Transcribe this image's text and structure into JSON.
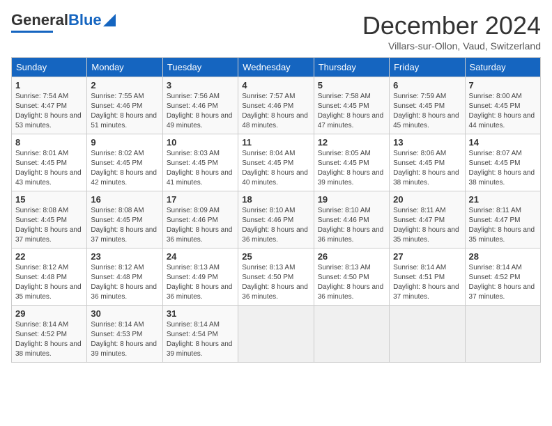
{
  "header": {
    "logo_general": "General",
    "logo_blue": "Blue",
    "title": "December 2024",
    "location": "Villars-sur-Ollon, Vaud, Switzerland"
  },
  "calendar": {
    "days_of_week": [
      "Sunday",
      "Monday",
      "Tuesday",
      "Wednesday",
      "Thursday",
      "Friday",
      "Saturday"
    ],
    "weeks": [
      [
        null,
        null,
        null,
        null,
        null,
        null,
        null
      ]
    ]
  },
  "cells": [
    {
      "day": "1",
      "sunrise": "7:54 AM",
      "sunset": "4:47 PM",
      "daylight": "8 hours and 53 minutes."
    },
    {
      "day": "2",
      "sunrise": "7:55 AM",
      "sunset": "4:46 PM",
      "daylight": "8 hours and 51 minutes."
    },
    {
      "day": "3",
      "sunrise": "7:56 AM",
      "sunset": "4:46 PM",
      "daylight": "8 hours and 49 minutes."
    },
    {
      "day": "4",
      "sunrise": "7:57 AM",
      "sunset": "4:46 PM",
      "daylight": "8 hours and 48 minutes."
    },
    {
      "day": "5",
      "sunrise": "7:58 AM",
      "sunset": "4:45 PM",
      "daylight": "8 hours and 47 minutes."
    },
    {
      "day": "6",
      "sunrise": "7:59 AM",
      "sunset": "4:45 PM",
      "daylight": "8 hours and 45 minutes."
    },
    {
      "day": "7",
      "sunrise": "8:00 AM",
      "sunset": "4:45 PM",
      "daylight": "8 hours and 44 minutes."
    },
    {
      "day": "8",
      "sunrise": "8:01 AM",
      "sunset": "4:45 PM",
      "daylight": "8 hours and 43 minutes."
    },
    {
      "day": "9",
      "sunrise": "8:02 AM",
      "sunset": "4:45 PM",
      "daylight": "8 hours and 42 minutes."
    },
    {
      "day": "10",
      "sunrise": "8:03 AM",
      "sunset": "4:45 PM",
      "daylight": "8 hours and 41 minutes."
    },
    {
      "day": "11",
      "sunrise": "8:04 AM",
      "sunset": "4:45 PM",
      "daylight": "8 hours and 40 minutes."
    },
    {
      "day": "12",
      "sunrise": "8:05 AM",
      "sunset": "4:45 PM",
      "daylight": "8 hours and 39 minutes."
    },
    {
      "day": "13",
      "sunrise": "8:06 AM",
      "sunset": "4:45 PM",
      "daylight": "8 hours and 38 minutes."
    },
    {
      "day": "14",
      "sunrise": "8:07 AM",
      "sunset": "4:45 PM",
      "daylight": "8 hours and 38 minutes."
    },
    {
      "day": "15",
      "sunrise": "8:08 AM",
      "sunset": "4:45 PM",
      "daylight": "8 hours and 37 minutes."
    },
    {
      "day": "16",
      "sunrise": "8:08 AM",
      "sunset": "4:45 PM",
      "daylight": "8 hours and 37 minutes."
    },
    {
      "day": "17",
      "sunrise": "8:09 AM",
      "sunset": "4:46 PM",
      "daylight": "8 hours and 36 minutes."
    },
    {
      "day": "18",
      "sunrise": "8:10 AM",
      "sunset": "4:46 PM",
      "daylight": "8 hours and 36 minutes."
    },
    {
      "day": "19",
      "sunrise": "8:10 AM",
      "sunset": "4:46 PM",
      "daylight": "8 hours and 36 minutes."
    },
    {
      "day": "20",
      "sunrise": "8:11 AM",
      "sunset": "4:47 PM",
      "daylight": "8 hours and 35 minutes."
    },
    {
      "day": "21",
      "sunrise": "8:11 AM",
      "sunset": "4:47 PM",
      "daylight": "8 hours and 35 minutes."
    },
    {
      "day": "22",
      "sunrise": "8:12 AM",
      "sunset": "4:48 PM",
      "daylight": "8 hours and 35 minutes."
    },
    {
      "day": "23",
      "sunrise": "8:12 AM",
      "sunset": "4:48 PM",
      "daylight": "8 hours and 36 minutes."
    },
    {
      "day": "24",
      "sunrise": "8:13 AM",
      "sunset": "4:49 PM",
      "daylight": "8 hours and 36 minutes."
    },
    {
      "day": "25",
      "sunrise": "8:13 AM",
      "sunset": "4:50 PM",
      "daylight": "8 hours and 36 minutes."
    },
    {
      "day": "26",
      "sunrise": "8:13 AM",
      "sunset": "4:50 PM",
      "daylight": "8 hours and 36 minutes."
    },
    {
      "day": "27",
      "sunrise": "8:14 AM",
      "sunset": "4:51 PM",
      "daylight": "8 hours and 37 minutes."
    },
    {
      "day": "28",
      "sunrise": "8:14 AM",
      "sunset": "4:52 PM",
      "daylight": "8 hours and 37 minutes."
    },
    {
      "day": "29",
      "sunrise": "8:14 AM",
      "sunset": "4:52 PM",
      "daylight": "8 hours and 38 minutes."
    },
    {
      "day": "30",
      "sunrise": "8:14 AM",
      "sunset": "4:53 PM",
      "daylight": "8 hours and 39 minutes."
    },
    {
      "day": "31",
      "sunrise": "8:14 AM",
      "sunset": "4:54 PM",
      "daylight": "8 hours and 39 minutes."
    }
  ],
  "labels": {
    "sunrise": "Sunrise:",
    "sunset": "Sunset:",
    "daylight": "Daylight:"
  }
}
